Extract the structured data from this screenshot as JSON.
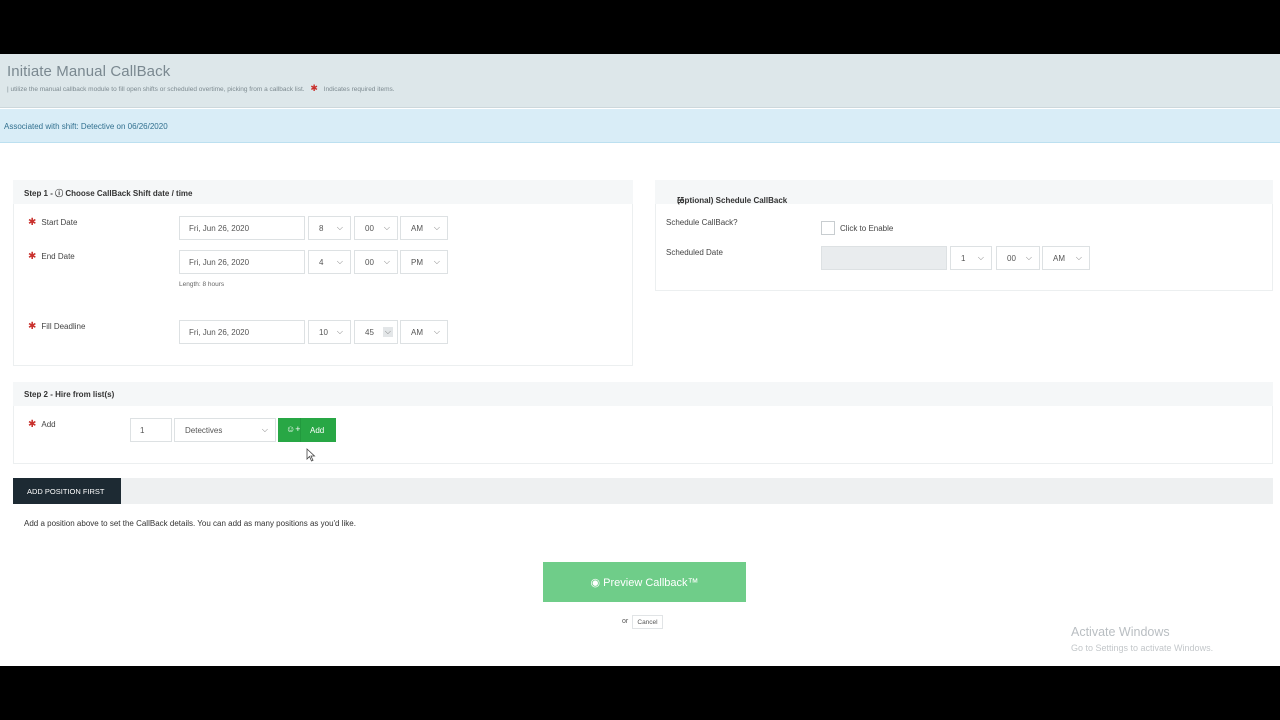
{
  "header": {
    "title": "Initiate Manual CallBack",
    "subtitle": "| utilize the manual callback module to fill open shifts or scheduled overtime, picking from a callback list.",
    "required_note": "Indicates required items."
  },
  "alert": {
    "text": "Associated with shift: Detective on 06/26/2020"
  },
  "step1": {
    "heading": "Step 1 - ⓘ Choose CallBack Shift date / time",
    "start": {
      "label": "Start Date",
      "date": "Fri, Jun 26, 2020",
      "hour": "8",
      "minute": "00",
      "ampm": "AM"
    },
    "end": {
      "label": "End Date",
      "date": "Fri, Jun 26, 2020",
      "hour": "4",
      "minute": "00",
      "ampm": "PM"
    },
    "length": "Length: 8 hours",
    "deadline": {
      "label": "Fill Deadline",
      "date": "Fri, Jun 26, 2020",
      "hour": "10",
      "minute": "45",
      "ampm": "AM"
    }
  },
  "schedule": {
    "heading": "(optional) Schedule CallBack",
    "schedule_label": "Schedule CallBack?",
    "enable_label": "Click to Enable",
    "date_label": "Scheduled Date",
    "date_value": "",
    "hour": "1",
    "minute": "00",
    "ampm": "AM"
  },
  "step2": {
    "heading": "Step 2 - Hire from list(s)",
    "add_label": "Add",
    "quantity": "1",
    "list": "Detectives",
    "add_button": "Add"
  },
  "tabs": {
    "active": "ADD POSITION FIRST"
  },
  "note": "Add a position above to set the CallBack details. You can add as many positions as you'd like.",
  "preview_button": "Preview Callback™",
  "or_text": "or",
  "cancel": "Cancel",
  "watermark": {
    "title": "Activate Windows",
    "sub": "Go to Settings to activate Windows."
  },
  "icons": {
    "required": "asterisk-icon",
    "clock": "clock-icon",
    "calendar": "calendar-icon",
    "user": "user-icon",
    "add_user": "add-user-icon",
    "eye": "eye-icon",
    "chevron": "chevron-down-icon"
  },
  "colors": {
    "success": "#28a745",
    "preview": "#6fcd89",
    "info_bg": "#d9edf7",
    "required": "#c9302c",
    "dark_tab": "#1d2a33"
  }
}
